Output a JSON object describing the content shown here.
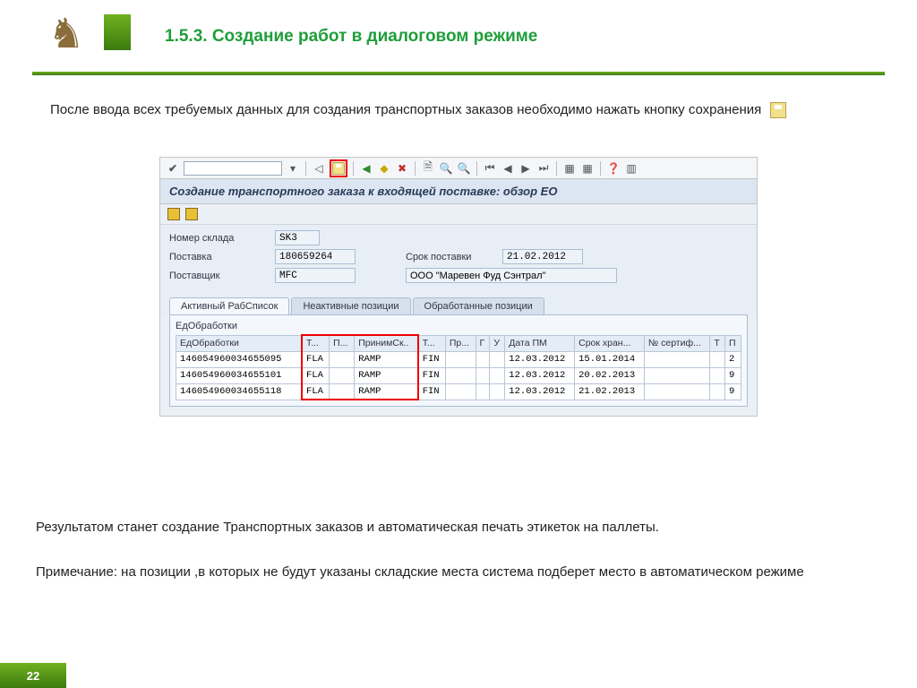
{
  "page": {
    "number": "22",
    "title": "1.5.3. Создание работ в диалоговом режиме",
    "intro": "После ввода всех требуемых данных для создания транспортных заказов необходимо нажать кнопку сохранения",
    "result": "Результатом станет создание Транспортных заказов и автоматическая печать этикеток на паллеты.",
    "note": "Примечание: на позиции ,в которых не будут указаны складские места система подберет место в автоматическом режиме"
  },
  "sap": {
    "title": "Создание транспортного заказа к входящей поставке: обзор ЕО",
    "form": {
      "warehouse_label": "Номер склада",
      "warehouse": "SK3",
      "delivery_label": "Поставка",
      "delivery": "180659264",
      "due_label": "Срок поставки",
      "due": "21.02.2012",
      "vendor_label": "Поставщик",
      "vendor": "MFC",
      "vendor_name": "ООО \"Маревен Фуд Сэнтрал\""
    },
    "tabs": {
      "active": "Активный РабСписок",
      "inactive": "Неактивные позиции",
      "processed": "Обработанные позиции"
    },
    "table": {
      "caption": "ЕдОбработки",
      "headers": {
        "c0": "ЕдОбработки",
        "c1": "Т...",
        "c2": "П...",
        "c3": "ПринимСк..",
        "c4": "Т...",
        "c5": "Пр...",
        "c6": "Г",
        "c7": "У",
        "c8": "Дата ПМ",
        "c9": "Срок хран...",
        "c10": "№ сертиф...",
        "c11": "Т",
        "c12": "П"
      },
      "rows": [
        {
          "id": "146054960034655095",
          "t": "FLA",
          "dest": "RAMP",
          "t2": "FIN",
          "date": "12.03.2012",
          "exp": "15.01.2014",
          "last": "2"
        },
        {
          "id": "146054960034655101",
          "t": "FLA",
          "dest": "RAMP",
          "t2": "FIN",
          "date": "12.03.2012",
          "exp": "20.02.2013",
          "last": "9"
        },
        {
          "id": "146054960034655118",
          "t": "FLA",
          "dest": "RAMP",
          "t2": "FIN",
          "date": "12.03.2012",
          "exp": "21.02.2013",
          "last": "9"
        }
      ]
    }
  }
}
